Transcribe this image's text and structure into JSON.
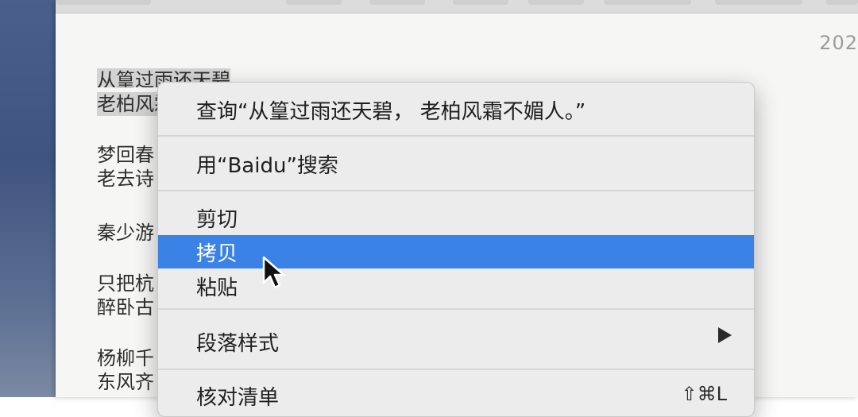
{
  "document": {
    "date_fragment": "202",
    "poem_lines": [
      "从篁过雨还天碧",
      "老柏风霜不媚人。",
      "梦回春",
      "老去诗",
      "秦少游",
      "只把杭",
      "醉卧古",
      "杨柳千",
      "东风齐"
    ]
  },
  "context_menu": {
    "lookup": "查询“从篁过雨还天碧， 老柏风霜不媚人。”",
    "search_baidu": "用“Baidu”搜索",
    "cut": "剪切",
    "copy": "拷贝",
    "paste": "粘贴",
    "paragraph_style": "段落样式",
    "checklist": "核对清单",
    "checklist_shortcut": "⇧⌘L",
    "highlighted_item": "拷贝"
  },
  "colors": {
    "highlight": "#3a82e6",
    "selection": "#d3d3d3",
    "menu_bg": "#ececec"
  },
  "icons": {
    "submenu_arrow": "triangle-right-icon",
    "cursor": "mouse-pointer-icon"
  }
}
